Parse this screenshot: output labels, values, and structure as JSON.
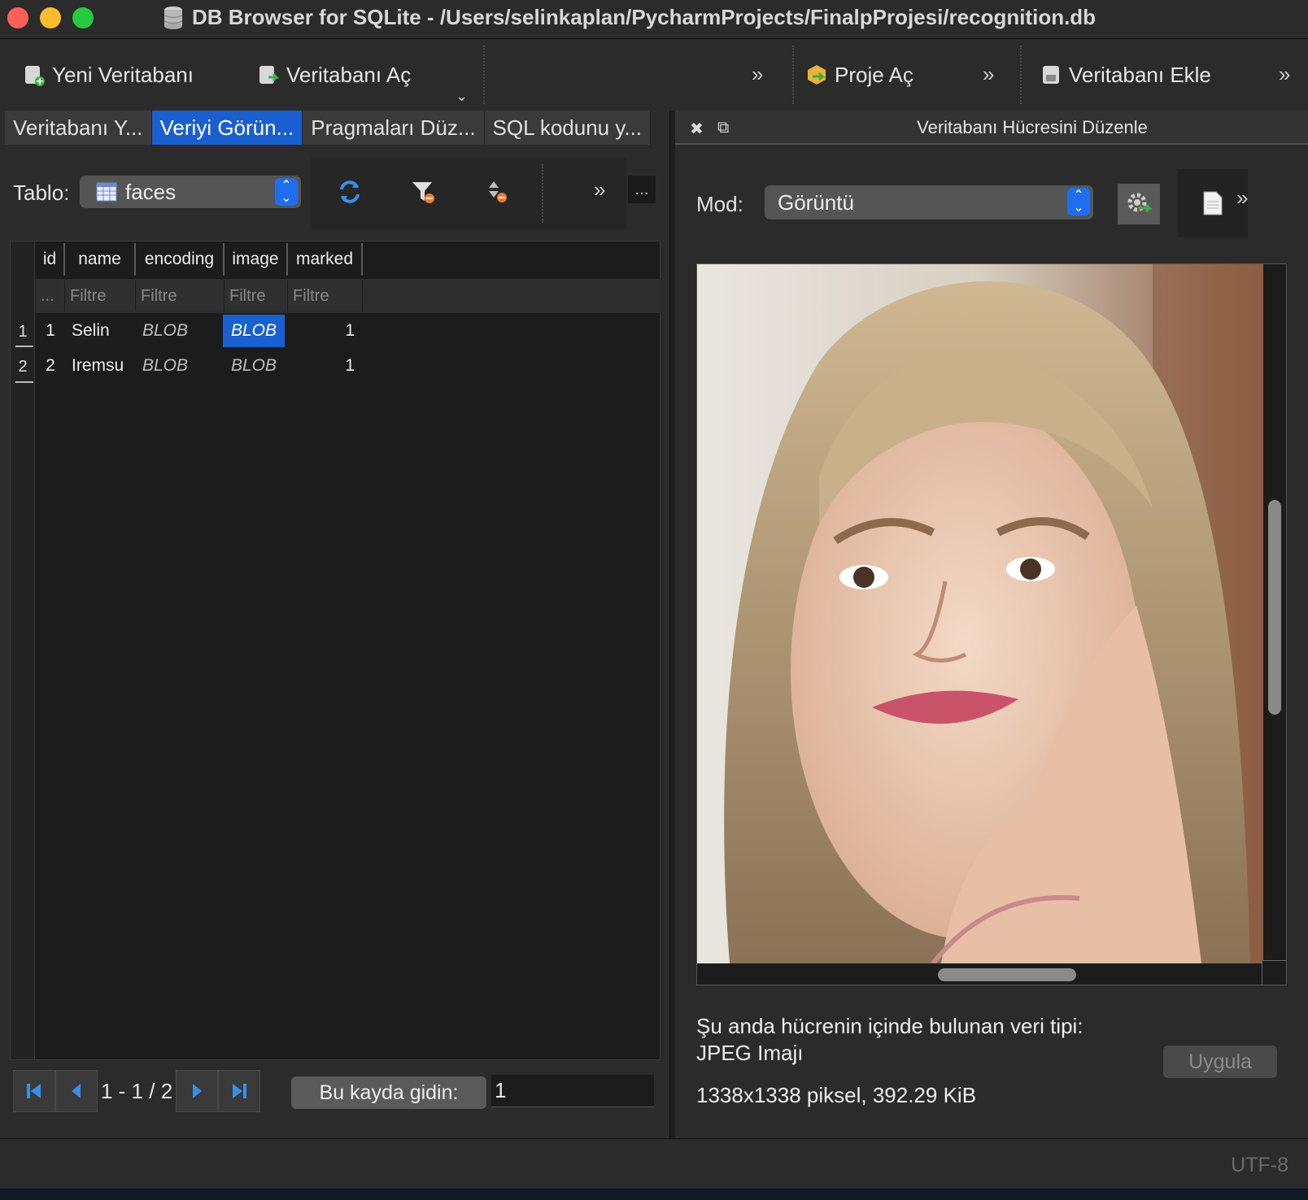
{
  "window": {
    "title": "DB Browser for SQLite - /Users/selinkaplan/PycharmProjects/FinalpProjesi/recognition.db"
  },
  "toolbar": {
    "new_db": "Yeni Veritabanı",
    "open_db": "Veritabanı Aç",
    "open_project": "Proje Aç",
    "attach_db": "Veritabanı Ekle"
  },
  "tabs": [
    {
      "label": "Veritabanı Y...",
      "active": false
    },
    {
      "label": "Veriyi Görün...",
      "active": true
    },
    {
      "label": "Pragmaları Düz...",
      "active": false
    },
    {
      "label": "SQL kodunu y...",
      "active": false
    }
  ],
  "browse": {
    "table_label": "Tablo:",
    "table_value": "faces",
    "more": "..."
  },
  "grid": {
    "columns": [
      "id",
      "name",
      "encoding",
      "image",
      "marked"
    ],
    "filter_first": "...",
    "filter_placeholder": "Filtre",
    "rows": [
      {
        "rownum": "1",
        "id": "1",
        "name": "Selin",
        "encoding": "BLOB",
        "image": "BLOB",
        "marked": "1"
      },
      {
        "rownum": "2",
        "id": "2",
        "name": "Iremsu",
        "encoding": "BLOB",
        "image": "BLOB",
        "marked": "1"
      }
    ]
  },
  "nav": {
    "record_range": "1 - 1 / 2",
    "goto_label": "Bu kayda gidin:",
    "goto_value": "1"
  },
  "editor": {
    "title": "Veritabanı Hücresini Düzenle",
    "mode_label": "Mod:",
    "mode_value": "Görüntü",
    "type_line1": "Şu anda hücrenin içinde bulunan veri tipi:",
    "type_line2": "JPEG Imajı",
    "size_info": "1338x1338 piksel, 392.29 KiB",
    "apply_label": "Uygula"
  },
  "statusbar": {
    "encoding": "UTF-8"
  },
  "colors": {
    "accent": "#1a5fd0",
    "close": "#ff5f57",
    "minimize": "#febc2e",
    "maximize": "#28c840"
  }
}
